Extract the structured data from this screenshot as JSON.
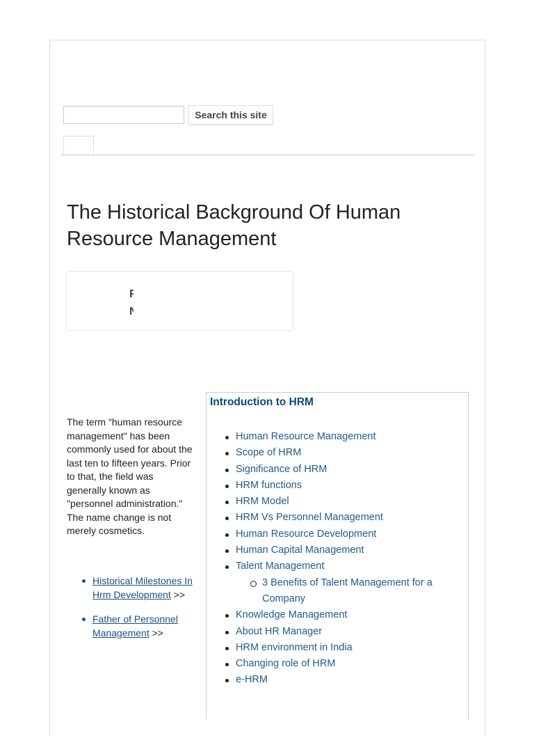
{
  "search": {
    "placeholder": "",
    "button_label": "Search this site"
  },
  "article": {
    "title": "The Historical Background Of Human Resource Management",
    "embed_fragment": "F\nN",
    "intro": "The term \"human resource management\" has been commonly used for about the last ten to fifteen years. Prior to that, the field was generally known as \"personnel administration.\" The name change is not merely cosmetics.",
    "related": [
      {
        "label": "Historical Milestones In Hrm Development",
        "suffix": " >>"
      },
      {
        "label": "Father of Personnel Management",
        "suffix": " >>"
      }
    ]
  },
  "toc": {
    "heading": "Introduction to HRM",
    "items": [
      {
        "label": "Human Resource Management"
      },
      {
        "label": "Scope of HRM"
      },
      {
        "label": "Significance of HRM"
      },
      {
        "label": "HRM functions"
      },
      {
        "label": "HRM Model"
      },
      {
        "label": "HRM Vs Personnel Management"
      },
      {
        "label": "Human Resource Development"
      },
      {
        "label": "Human Capital Management"
      },
      {
        "label": "Talent Management"
      },
      {
        "label": "3 Benefits of Talent Management for a Company"
      },
      {
        "label": "Knowledge Management"
      },
      {
        "label": "About HR Manager"
      },
      {
        "label": "HRM environment in India"
      },
      {
        "label": "Changing role of HRM"
      },
      {
        "label": "e-HRM"
      }
    ]
  }
}
